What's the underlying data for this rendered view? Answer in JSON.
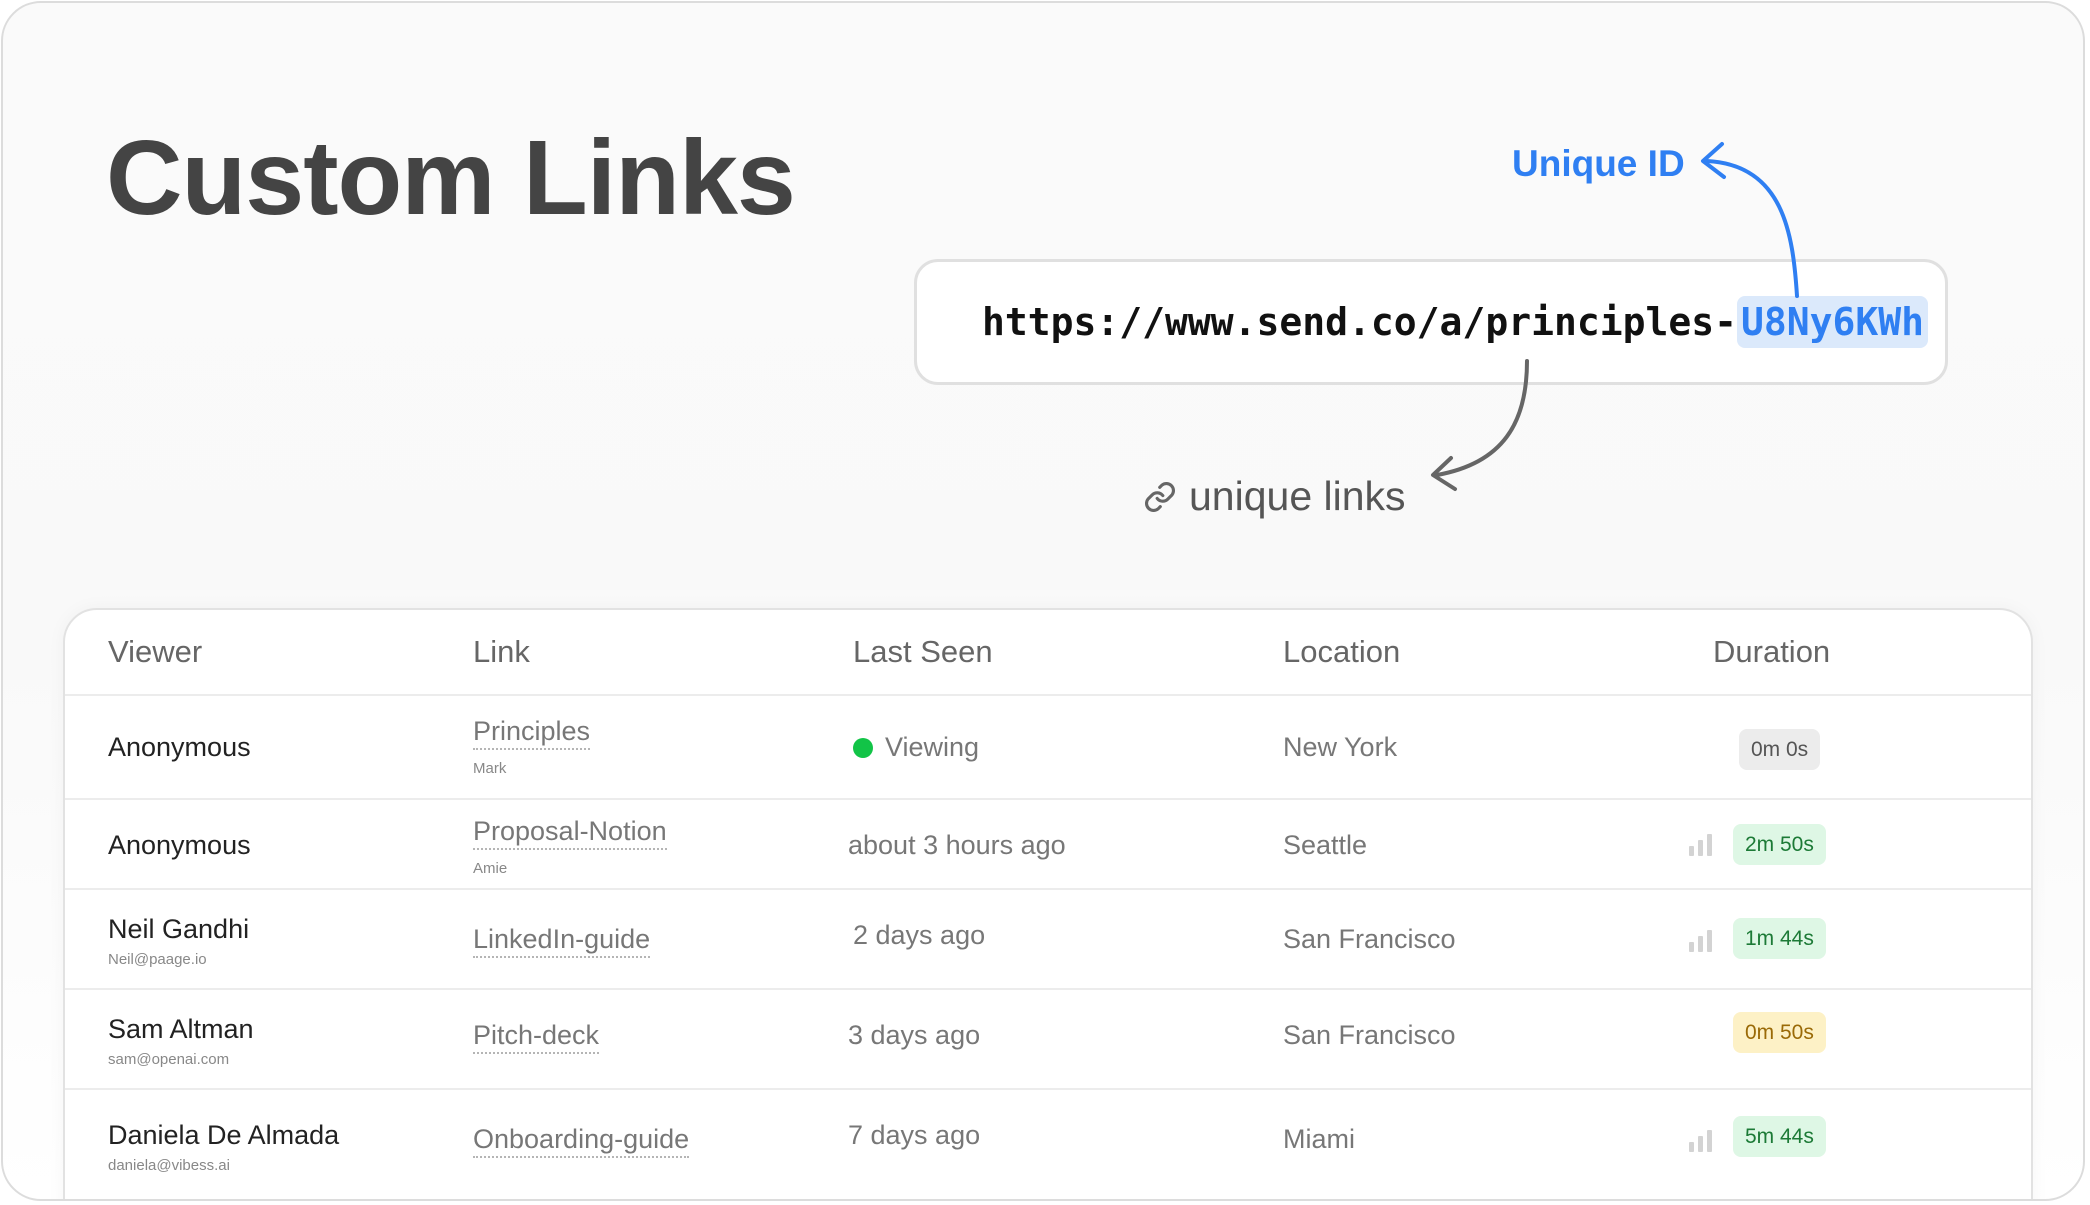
{
  "title": "Custom Links",
  "url": {
    "base": "https://www.send.co/a/principles-",
    "id": "U8Ny6KWh"
  },
  "annotations": {
    "unique_id": "Unique ID",
    "unique_links": "unique links"
  },
  "colors": {
    "accent": "#2f7ff2",
    "viewing_dot": "#12c447",
    "badge_green_bg": "#def7e5",
    "badge_yellow_bg": "#fdf1c6"
  },
  "table": {
    "headers": {
      "viewer": "Viewer",
      "link": "Link",
      "last_seen": "Last Seen",
      "location": "Location",
      "duration": "Duration"
    },
    "rows": [
      {
        "viewer": "Anonymous",
        "viewer_sub": "",
        "link": "Principles",
        "link_sub": "Mark",
        "last_seen": "Viewing",
        "location": "New York",
        "duration": "0m 0s",
        "duration_style": "gray",
        "engagement_icon": false
      },
      {
        "viewer": "Anonymous",
        "viewer_sub": "",
        "link": "Proposal-Notion",
        "link_sub": "Amie",
        "last_seen": "about 3 hours ago",
        "location": "Seattle",
        "duration": "2m 50s",
        "duration_style": "green",
        "engagement_icon": true
      },
      {
        "viewer": "Neil Gandhi",
        "viewer_sub": "Neil@paage.io",
        "link": "LinkedIn-guide",
        "link_sub": "",
        "last_seen": "2 days ago",
        "location": "San Francisco",
        "duration": "1m 44s",
        "duration_style": "green",
        "engagement_icon": true
      },
      {
        "viewer": "Sam Altman",
        "viewer_sub": "sam@openai.com",
        "link": "Pitch-deck",
        "link_sub": "",
        "last_seen": "3 days ago",
        "location": "San Francisco",
        "duration": "0m 50s",
        "duration_style": "yellow",
        "engagement_icon": false
      },
      {
        "viewer": "Daniela De Almada",
        "viewer_sub": "daniela@vibess.ai",
        "link": "Onboarding-guide",
        "link_sub": "",
        "last_seen": "7 days ago",
        "location": "Miami",
        "duration": "5m 44s",
        "duration_style": "green",
        "engagement_icon": true
      }
    ]
  }
}
